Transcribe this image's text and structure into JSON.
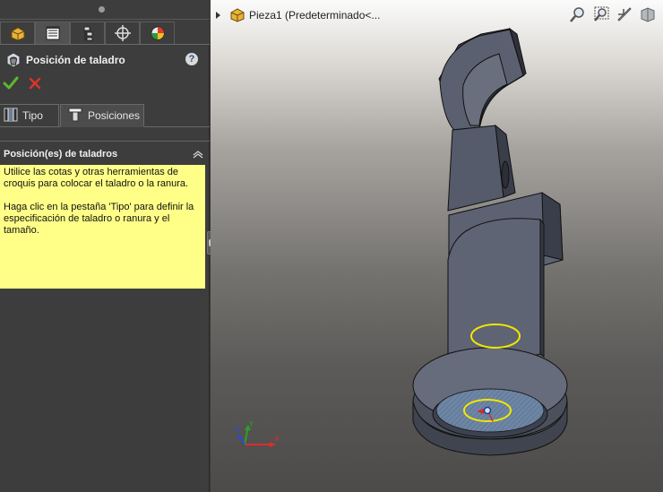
{
  "property_manager": {
    "feature_title": "Posición de taladro",
    "help_label": "?",
    "tabs": [
      "feature-manager",
      "property-manager",
      "configuration-manager",
      "dimxpert-manager",
      "display-manager"
    ],
    "subtabs": {
      "type_label": "Tipo",
      "positions_label": "Posiciones"
    },
    "group": {
      "title": "Posición(es) de taladros",
      "message_p1": "Utilice las cotas y otras herramientas de croquis para colocar el taladro o la ranura.",
      "message_p2": "Haga clic en la pestaña 'Tipo' para definir la especificación de taladro o ranura y el tamaño."
    }
  },
  "graphics": {
    "tree_label": "Pieza1  (Predeterminado<...",
    "view_tools": [
      "zoom-to-fit-icon",
      "zoom-to-area-icon",
      "previous-view-icon",
      "section-view-icon"
    ],
    "triad_axes": [
      "X",
      "Y",
      "Z"
    ]
  },
  "colors": {
    "panel_bg": "#3d3d3d",
    "message_bg": "#ffff88",
    "ok_green": "#5cb82e",
    "cancel_red": "#e0322a",
    "preview_yellow": "#f2e600",
    "model_face": "#555b6b"
  }
}
